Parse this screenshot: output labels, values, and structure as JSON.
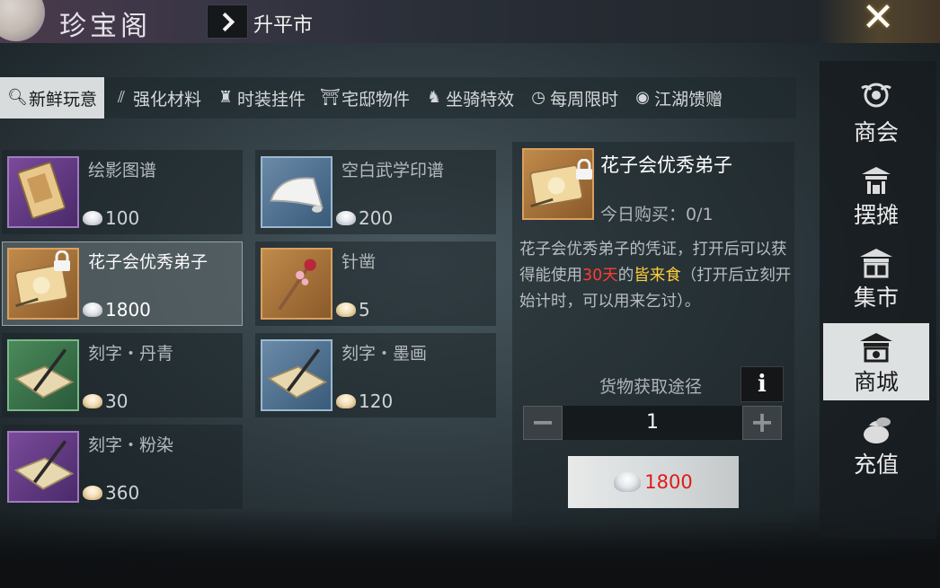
{
  "header": {
    "title": "珍宝阁",
    "location": "升平市"
  },
  "tabs": [
    {
      "label": "新鲜玩意",
      "icon": "magnifier-icon",
      "active": true
    },
    {
      "label": "强化材料",
      "icon": "claw-icon",
      "active": false
    },
    {
      "label": "时装挂件",
      "icon": "robe-icon",
      "active": false
    },
    {
      "label": "宅邸物件",
      "icon": "house-icon",
      "active": false
    },
    {
      "label": "坐骑特效",
      "icon": "horse-icon",
      "active": false
    },
    {
      "label": "每周限时",
      "icon": "clock-icon",
      "active": false
    },
    {
      "label": "江湖馈赠",
      "icon": "coin-icon",
      "active": false
    }
  ],
  "items": [
    {
      "name": "绘影图谱",
      "price": "100",
      "currency": "silver",
      "rarity": "purple",
      "locked": false
    },
    {
      "name": "空白武学印谱",
      "price": "200",
      "currency": "silver",
      "rarity": "blue",
      "locked": false
    },
    {
      "name": "花子会优秀弟子",
      "price": "1800",
      "currency": "silver",
      "rarity": "orange",
      "locked": true,
      "selected": true
    },
    {
      "name": "针凿",
      "price": "5",
      "currency": "gold",
      "rarity": "orange",
      "locked": false
    },
    {
      "name": "刻字・丹青",
      "price": "30",
      "currency": "gold",
      "rarity": "green",
      "locked": false
    },
    {
      "name": "刻字・墨画",
      "price": "120",
      "currency": "gold",
      "rarity": "blue",
      "locked": false
    },
    {
      "name": "刻字・粉染",
      "price": "360",
      "currency": "gold",
      "rarity": "purple",
      "locked": false
    }
  ],
  "detail": {
    "name": "花子会优秀弟子",
    "daily_label": "今日购买：",
    "daily_value": "0/1",
    "desc_part1": "花子会优秀弟子的凭证，打开后可以获得能使用",
    "desc_days": "30天",
    "desc_part2": "的",
    "desc_item": "皆来食",
    "desc_part3": "（打开后立刻开始计时，可以用来乞讨）。",
    "source_label": "货物获取途径",
    "info_label": "i",
    "minus_label": "−",
    "plus_label": "+",
    "quantity": "1",
    "buy_price": "1800"
  },
  "side_nav": [
    {
      "label": "商会",
      "icon": "guild-icon",
      "active": false
    },
    {
      "label": "摆摊",
      "icon": "stall-icon",
      "active": false
    },
    {
      "label": "集市",
      "icon": "market-icon",
      "active": false
    },
    {
      "label": "商城",
      "icon": "mall-icon",
      "active": true
    },
    {
      "label": "充值",
      "icon": "money-bag-icon",
      "active": false
    }
  ],
  "colors": {
    "price_red": "#e01a1a",
    "days_red": "#ff3b30",
    "item_yellow": "#ffcf3a",
    "active_tab_bg": "#d8dcdc"
  }
}
